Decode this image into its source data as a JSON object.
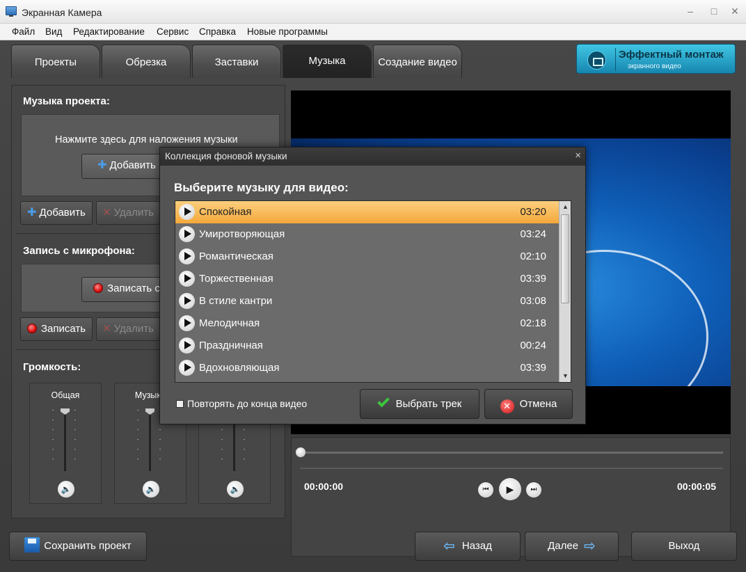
{
  "window": {
    "title": "Экранная Камера",
    "min": "–",
    "max": "□",
    "close": "✕"
  },
  "menu": [
    "Файл",
    "Вид",
    "Редактирование",
    "Сервис",
    "Справка",
    "Новые программы"
  ],
  "tabs": [
    "Проекты",
    "Обрезка",
    "Заставки",
    "Музыка",
    "Создание видео"
  ],
  "promo": {
    "line1": "Эффектный монтаж",
    "line2": "экранного видео"
  },
  "music_section": {
    "title": "Музыка проекта:",
    "hint": "Нажмите здесь для наложения музыки",
    "inner_add": "Добавить",
    "add": "Добавить",
    "delete": "Удалить"
  },
  "mic_section": {
    "title": "Запись с микрофона:",
    "inner_record": "Записать с",
    "record": "Записать",
    "delete": "Удалить"
  },
  "volume": {
    "title": "Громкость:",
    "channels": [
      "Общая",
      "Музыка",
      ""
    ]
  },
  "player": {
    "time_start": "00:00:00",
    "time_end": "00:00:05"
  },
  "bottom": {
    "save": "Сохранить проект",
    "back": "Назад",
    "next": "Далее",
    "exit": "Выход"
  },
  "dialog": {
    "title": "Коллекция фоновой музыки",
    "close": "×",
    "heading": "Выберите музыку для видео:",
    "tracks": [
      {
        "name": "Спокойная",
        "duration": "03:20"
      },
      {
        "name": "Умиротворяющая",
        "duration": "03:24"
      },
      {
        "name": "Романтическая",
        "duration": "02:10"
      },
      {
        "name": "Торжественная",
        "duration": "03:39"
      },
      {
        "name": "В стиле кантри",
        "duration": "03:08"
      },
      {
        "name": "Мелодичная",
        "duration": "02:18"
      },
      {
        "name": "Праздничная",
        "duration": "00:24"
      },
      {
        "name": "Вдохновляющая",
        "duration": "03:39"
      }
    ],
    "selected_index": 0,
    "repeat_label": "Повторять до конца видео",
    "choose": "Выбрать трек",
    "cancel": "Отмена"
  },
  "colors": {
    "selected_row": "#f4a83b",
    "accent_blue": "#1786b0"
  }
}
